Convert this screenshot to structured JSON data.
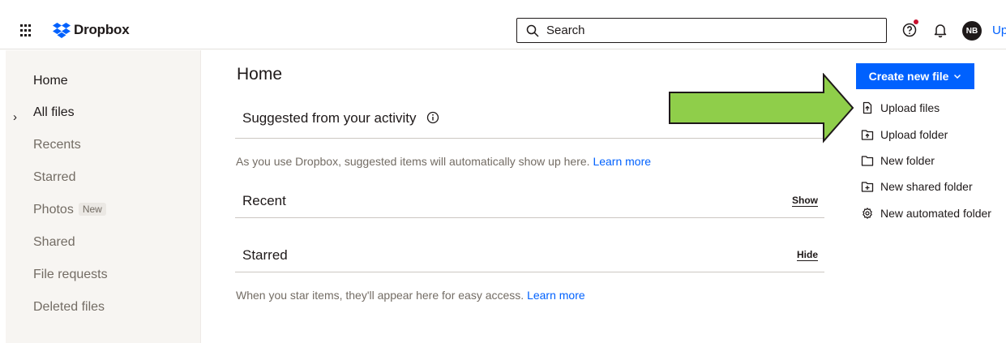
{
  "header": {
    "logo_text": "Dropbox",
    "search_placeholder": "Search",
    "avatar_initials": "NB",
    "upgrade_text": "Up",
    "brand_color": "#0061fe",
    "notification_dot_color": "#c8102e"
  },
  "sidebar": {
    "items": [
      {
        "label": "Home",
        "active": true
      },
      {
        "label": "All files",
        "expandable": true
      },
      {
        "label": "Recents"
      },
      {
        "label": "Starred"
      },
      {
        "label": "Photos",
        "badge": "New"
      },
      {
        "label": "Shared"
      },
      {
        "label": "File requests"
      },
      {
        "label": "Deleted files"
      }
    ]
  },
  "main": {
    "title": "Home",
    "suggested": {
      "title": "Suggested from your activity",
      "hint": "As you use Dropbox, suggested items will automatically show up here.",
      "link": "Learn more"
    },
    "recent": {
      "title": "Recent",
      "action": "Show"
    },
    "starred": {
      "title": "Starred",
      "action": "Hide",
      "hint": "When you star items, they'll appear here for easy access.",
      "link": "Learn more"
    }
  },
  "actions": {
    "create_label": "Create new file",
    "items": [
      {
        "label": "Upload files",
        "icon": "upload-file-icon"
      },
      {
        "label": "Upload folder",
        "icon": "upload-folder-icon"
      },
      {
        "label": "New folder",
        "icon": "folder-icon"
      },
      {
        "label": "New shared folder",
        "icon": "shared-folder-icon"
      },
      {
        "label": "New automated folder",
        "icon": "automated-folder-icon"
      }
    ]
  },
  "annotation": {
    "arrow_color": "#8fce4a",
    "arrow_target": "Upload files"
  }
}
